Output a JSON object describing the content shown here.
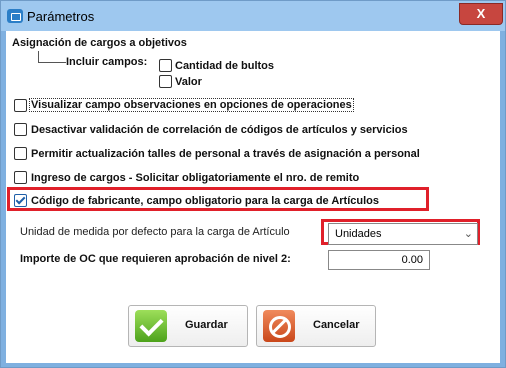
{
  "window": {
    "title": "Parámetros",
    "close_label": "X"
  },
  "assignment": {
    "heading": "Asignación de cargos a objetivos",
    "include_label": "Incluir campos:",
    "fields": [
      {
        "label": "Cantidad de bultos",
        "checked": false
      },
      {
        "label": "Valor",
        "checked": false
      }
    ]
  },
  "options": [
    {
      "label": "Visualizar campo observaciones en opciones de operaciones",
      "checked": false
    },
    {
      "label": "Desactivar validación de correlación de códigos de artículos y servicios",
      "checked": false
    },
    {
      "label": "Permitir actualización talles de personal a través de asignación a personal",
      "checked": false
    },
    {
      "label": "Ingreso de cargos - Solicitar obligatoriamente el nro. de remito",
      "checked": false
    },
    {
      "label": "Código de fabricante, campo obligatorio para la carga de Artículos",
      "checked": true
    }
  ],
  "unit_field": {
    "label": "Unidad de medida por defecto para la carga de Artículo",
    "value": "Unidades"
  },
  "oc_field": {
    "label": "Importe de OC que requieren aprobación de nivel 2:",
    "value": "0.00"
  },
  "buttons": {
    "save": "Guardar",
    "cancel": "Cancelar"
  },
  "colors": {
    "highlight": "#e0202a",
    "titlebar": "#9ec8ef",
    "ok": "#4da21b",
    "cancel": "#c9471a"
  }
}
